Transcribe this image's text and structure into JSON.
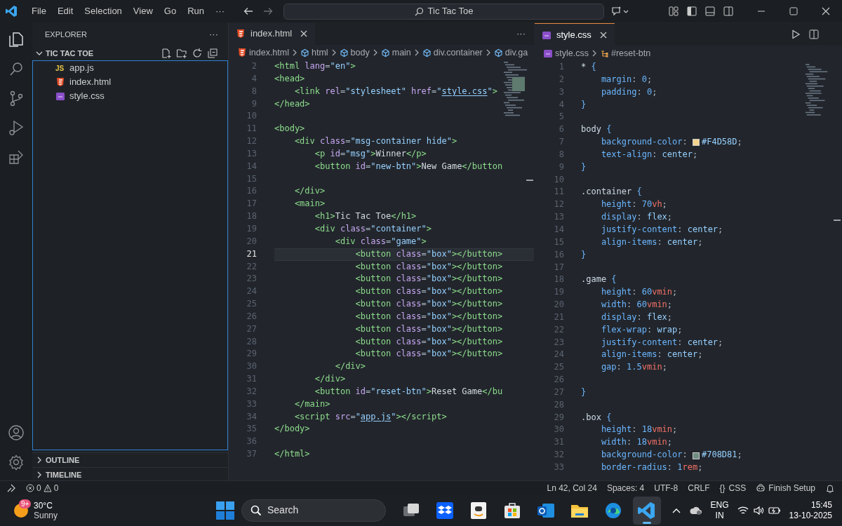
{
  "title_bar": {
    "menu": [
      "File",
      "Edit",
      "Selection",
      "View",
      "Go",
      "Run",
      "···"
    ],
    "search": "Tic Tac Toe"
  },
  "sidebar": {
    "title": "EXPLORER",
    "more": "···",
    "folder": {
      "name": "TIC TAC TOE",
      "expanded": true,
      "files": [
        {
          "name": "app.js",
          "kind": "js",
          "badge": "JS"
        },
        {
          "name": "index.html",
          "kind": "html"
        },
        {
          "name": "style.css",
          "kind": "css"
        }
      ]
    },
    "sections": [
      {
        "name": "OUTLINE",
        "expanded": false
      },
      {
        "name": "TIMELINE",
        "expanded": false
      }
    ]
  },
  "editors": [
    {
      "focused": false,
      "more": "···",
      "tabs": [
        {
          "label": "index.html",
          "kind": "html",
          "selected": true
        }
      ],
      "breadcrumbs": [
        {
          "label": "index.html",
          "kind": "html"
        },
        {
          "label": "html",
          "kind": "element"
        },
        {
          "label": "body",
          "kind": "element"
        },
        {
          "label": "main",
          "kind": "element"
        },
        {
          "label": "div.container",
          "kind": "element"
        },
        {
          "label": "div.ga",
          "kind": "element"
        }
      ],
      "lines": [
        {
          "number": "2",
          "current": false,
          "tokens": [
            {
              "kind": "tag",
              "text": "<html"
            },
            {
              "kind": "attr",
              "text": " lang"
            },
            {
              "kind": "p",
              "text": "="
            },
            {
              "kind": "str",
              "text": "\"en\""
            },
            {
              "kind": "tag",
              "text": ">"
            }
          ]
        },
        {
          "number": "4",
          "current": false,
          "tokens": [
            {
              "kind": "tag",
              "text": "<head>"
            }
          ]
        },
        {
          "number": "8",
          "current": false,
          "tokens": [
            {
              "kind": "tag",
              "text": "    <link"
            },
            {
              "kind": "attr",
              "text": " rel"
            },
            {
              "kind": "p",
              "text": "="
            },
            {
              "kind": "str",
              "text": "\"stylesheet\""
            },
            {
              "kind": "attr",
              "text": " href"
            },
            {
              "kind": "p",
              "text": "="
            },
            {
              "kind": "str",
              "text": "\""
            },
            {
              "kind": "link",
              "text": "style.css"
            },
            {
              "kind": "str",
              "text": "\""
            },
            {
              "kind": "tag",
              "text": ">"
            }
          ]
        },
        {
          "number": "9",
          "current": false,
          "tokens": [
            {
              "kind": "tag",
              "text": "</head>"
            }
          ]
        },
        {
          "number": "10",
          "current": false
        },
        {
          "number": "11",
          "current": false,
          "tokens": [
            {
              "kind": "tag",
              "text": "<body>"
            }
          ]
        },
        {
          "number": "12",
          "current": false,
          "tokens": [
            {
              "kind": "tag",
              "text": "    <div"
            },
            {
              "kind": "attr",
              "text": " class"
            },
            {
              "kind": "p",
              "text": "="
            },
            {
              "kind": "str",
              "text": "\"msg-container hide\""
            },
            {
              "kind": "tag",
              "text": ">"
            }
          ]
        },
        {
          "number": "13",
          "current": false,
          "tokens": [
            {
              "kind": "tag",
              "text": "        <p"
            },
            {
              "kind": "attr",
              "text": " id"
            },
            {
              "kind": "p",
              "text": "="
            },
            {
              "kind": "str",
              "text": "\"msg\""
            },
            {
              "kind": "tag",
              "text": ">"
            },
            {
              "kind": "text",
              "text": "Winner"
            },
            {
              "kind": "tag",
              "text": "</p>"
            }
          ]
        },
        {
          "number": "14",
          "current": false,
          "tokens": [
            {
              "kind": "tag",
              "text": "        <button"
            },
            {
              "kind": "attr",
              "text": " id"
            },
            {
              "kind": "p",
              "text": "="
            },
            {
              "kind": "str",
              "text": "\"new-btn\""
            },
            {
              "kind": "tag",
              "text": ">"
            },
            {
              "kind": "text",
              "text": "New Game"
            },
            {
              "kind": "tag",
              "text": "</button"
            }
          ]
        },
        {
          "number": "15",
          "current": false
        },
        {
          "number": "16",
          "current": false,
          "tokens": [
            {
              "kind": "tag",
              "text": "    </div>"
            }
          ]
        },
        {
          "number": "17",
          "current": false,
          "tokens": [
            {
              "kind": "tag",
              "text": "    <main>"
            }
          ]
        },
        {
          "number": "18",
          "current": false,
          "tokens": [
            {
              "kind": "tag",
              "text": "        <h1>"
            },
            {
              "kind": "text",
              "text": "Tic Tac Toe"
            },
            {
              "kind": "tag",
              "text": "</h1>"
            }
          ]
        },
        {
          "number": "19",
          "current": false,
          "tokens": [
            {
              "kind": "tag",
              "text": "        <div"
            },
            {
              "kind": "attr",
              "text": " class"
            },
            {
              "kind": "p",
              "text": "="
            },
            {
              "kind": "str",
              "text": "\"container\""
            },
            {
              "kind": "tag",
              "text": ">"
            }
          ]
        },
        {
          "number": "20",
          "current": false,
          "tokens": [
            {
              "kind": "tag",
              "text": "            <div"
            },
            {
              "kind": "attr",
              "text": " class"
            },
            {
              "kind": "p",
              "text": "="
            },
            {
              "kind": "str",
              "text": "\"game\""
            },
            {
              "kind": "tag",
              "text": ">"
            }
          ]
        },
        {
          "number": "21",
          "current": true,
          "tokens": [
            {
              "kind": "tag",
              "text": "                <button"
            },
            {
              "kind": "attr",
              "text": " class"
            },
            {
              "kind": "p",
              "text": "="
            },
            {
              "kind": "str",
              "text": "\"box\""
            },
            {
              "kind": "tag",
              "text": "></button>"
            }
          ]
        },
        {
          "number": "22",
          "current": false,
          "tokens": [
            {
              "kind": "tag",
              "text": "                <button"
            },
            {
              "kind": "attr",
              "text": " class"
            },
            {
              "kind": "p",
              "text": "="
            },
            {
              "kind": "str",
              "text": "\"box\""
            },
            {
              "kind": "tag",
              "text": "></button>"
            }
          ]
        },
        {
          "number": "23",
          "current": false,
          "tokens": [
            {
              "kind": "tag",
              "text": "                <button"
            },
            {
              "kind": "attr",
              "text": " class"
            },
            {
              "kind": "p",
              "text": "="
            },
            {
              "kind": "str",
              "text": "\"box\""
            },
            {
              "kind": "tag",
              "text": "></button>"
            }
          ]
        },
        {
          "number": "24",
          "current": false,
          "tokens": [
            {
              "kind": "tag",
              "text": "                <button"
            },
            {
              "kind": "attr",
              "text": " class"
            },
            {
              "kind": "p",
              "text": "="
            },
            {
              "kind": "str",
              "text": "\"box\""
            },
            {
              "kind": "tag",
              "text": "></button>"
            }
          ]
        },
        {
          "number": "25",
          "current": false,
          "tokens": [
            {
              "kind": "tag",
              "text": "                <button"
            },
            {
              "kind": "attr",
              "text": " class"
            },
            {
              "kind": "p",
              "text": "="
            },
            {
              "kind": "str",
              "text": "\"box\""
            },
            {
              "kind": "tag",
              "text": "></button>"
            }
          ]
        },
        {
          "number": "26",
          "current": false,
          "tokens": [
            {
              "kind": "tag",
              "text": "                <button"
            },
            {
              "kind": "attr",
              "text": " class"
            },
            {
              "kind": "p",
              "text": "="
            },
            {
              "kind": "str",
              "text": "\"box\""
            },
            {
              "kind": "tag",
              "text": "></button>"
            }
          ]
        },
        {
          "number": "27",
          "current": false,
          "tokens": [
            {
              "kind": "tag",
              "text": "                <button"
            },
            {
              "kind": "attr",
              "text": " class"
            },
            {
              "kind": "p",
              "text": "="
            },
            {
              "kind": "str",
              "text": "\"box\""
            },
            {
              "kind": "tag",
              "text": "></button>"
            }
          ]
        },
        {
          "number": "28",
          "current": false,
          "tokens": [
            {
              "kind": "tag",
              "text": "                <button"
            },
            {
              "kind": "attr",
              "text": " class"
            },
            {
              "kind": "p",
              "text": "="
            },
            {
              "kind": "str",
              "text": "\"box\""
            },
            {
              "kind": "tag",
              "text": "></button>"
            }
          ]
        },
        {
          "number": "29",
          "current": false,
          "tokens": [
            {
              "kind": "tag",
              "text": "                <button"
            },
            {
              "kind": "attr",
              "text": " class"
            },
            {
              "kind": "p",
              "text": "="
            },
            {
              "kind": "str",
              "text": "\"box\""
            },
            {
              "kind": "tag",
              "text": "></button>"
            }
          ]
        },
        {
          "number": "30",
          "current": false,
          "tokens": [
            {
              "kind": "tag",
              "text": "            </div>"
            }
          ]
        },
        {
          "number": "31",
          "current": false,
          "tokens": [
            {
              "kind": "tag",
              "text": "        </div>"
            }
          ]
        },
        {
          "number": "32",
          "current": false,
          "tokens": [
            {
              "kind": "tag",
              "text": "        <button"
            },
            {
              "kind": "attr",
              "text": " id"
            },
            {
              "kind": "p",
              "text": "="
            },
            {
              "kind": "str",
              "text": "\"reset-btn\""
            },
            {
              "kind": "tag",
              "text": ">"
            },
            {
              "kind": "text",
              "text": "Reset Game"
            },
            {
              "kind": "tag",
              "text": "</bu"
            }
          ]
        },
        {
          "number": "33",
          "current": false,
          "tokens": [
            {
              "kind": "tag",
              "text": "    </main>"
            }
          ]
        },
        {
          "number": "34",
          "current": false,
          "tokens": [
            {
              "kind": "tag",
              "text": "    <script"
            },
            {
              "kind": "attr",
              "text": " src"
            },
            {
              "kind": "p",
              "text": "="
            },
            {
              "kind": "str",
              "text": "\""
            },
            {
              "kind": "link",
              "text": "app.js"
            },
            {
              "kind": "str",
              "text": "\""
            },
            {
              "kind": "tag",
              "text": "></script>"
            }
          ]
        },
        {
          "number": "35",
          "current": false,
          "tokens": [
            {
              "kind": "tag",
              "text": "</body>"
            }
          ]
        },
        {
          "number": "36",
          "current": false
        },
        {
          "number": "37",
          "current": false,
          "tokens": [
            {
              "kind": "tag",
              "text": "</html>"
            }
          ]
        }
      ]
    },
    {
      "focused": true,
      "tabs": [
        {
          "label": "style.css",
          "kind": "css",
          "selected": true
        }
      ],
      "breadcrumbs": [
        {
          "label": "style.css",
          "kind": "css"
        },
        {
          "label": "#reset-btn",
          "kind": "selector"
        }
      ],
      "lines": [
        {
          "number": "1",
          "tokens": [
            {
              "kind": "sel",
              "text": "*"
            },
            {
              "kind": "brace",
              "text": " {"
            }
          ]
        },
        {
          "number": "2",
          "tokens": [
            {
              "kind": "prop",
              "text": "    margin"
            },
            {
              "kind": "p",
              "text": ": "
            },
            {
              "kind": "num",
              "text": "0"
            },
            {
              "kind": "p",
              "text": ";"
            }
          ]
        },
        {
          "number": "3",
          "tokens": [
            {
              "kind": "prop",
              "text": "    padding"
            },
            {
              "kind": "p",
              "text": ": "
            },
            {
              "kind": "num",
              "text": "0"
            },
            {
              "kind": "p",
              "text": ";"
            }
          ]
        },
        {
          "number": "4",
          "tokens": [
            {
              "kind": "brace",
              "text": "}"
            }
          ]
        },
        {
          "number": "5"
        },
        {
          "number": "6",
          "tokens": [
            {
              "kind": "sel",
              "text": "body"
            },
            {
              "kind": "brace",
              "text": " {"
            }
          ]
        },
        {
          "number": "7",
          "tokens": [
            {
              "kind": "prop",
              "text": "    background-color"
            },
            {
              "kind": "p",
              "text": ": "
            },
            {
              "kind": "swatch",
              "color": "#f4d58d"
            },
            {
              "kind": "val",
              "text": "#F4D58D"
            },
            {
              "kind": "p",
              "text": ";"
            }
          ]
        },
        {
          "number": "8",
          "tokens": [
            {
              "kind": "prop",
              "text": "    text-align"
            },
            {
              "kind": "p",
              "text": ": "
            },
            {
              "kind": "val",
              "text": "center"
            },
            {
              "kind": "p",
              "text": ";"
            }
          ]
        },
        {
          "number": "9",
          "tokens": [
            {
              "kind": "brace",
              "text": "}"
            }
          ]
        },
        {
          "number": "10"
        },
        {
          "number": "11",
          "tokens": [
            {
              "kind": "sel",
              "text": ".container"
            },
            {
              "kind": "brace",
              "text": " {"
            }
          ]
        },
        {
          "number": "12",
          "tokens": [
            {
              "kind": "prop",
              "text": "    height"
            },
            {
              "kind": "p",
              "text": ": "
            },
            {
              "kind": "num",
              "text": "70"
            },
            {
              "kind": "unit",
              "text": "vh"
            },
            {
              "kind": "p",
              "text": ";"
            }
          ]
        },
        {
          "number": "13",
          "tokens": [
            {
              "kind": "prop",
              "text": "    display"
            },
            {
              "kind": "p",
              "text": ": "
            },
            {
              "kind": "val",
              "text": "flex"
            },
            {
              "kind": "p",
              "text": ";"
            }
          ]
        },
        {
          "number": "14",
          "tokens": [
            {
              "kind": "prop",
              "text": "    justify-content"
            },
            {
              "kind": "p",
              "text": ": "
            },
            {
              "kind": "val",
              "text": "center"
            },
            {
              "kind": "p",
              "text": ";"
            }
          ]
        },
        {
          "number": "15",
          "tokens": [
            {
              "kind": "prop",
              "text": "    align-items"
            },
            {
              "kind": "p",
              "text": ": "
            },
            {
              "kind": "val",
              "text": "center"
            },
            {
              "kind": "p",
              "text": ";"
            }
          ]
        },
        {
          "number": "16",
          "tokens": [
            {
              "kind": "brace",
              "text": "}"
            }
          ]
        },
        {
          "number": "17"
        },
        {
          "number": "18",
          "tokens": [
            {
              "kind": "sel",
              "text": ".game"
            },
            {
              "kind": "brace",
              "text": " {"
            }
          ]
        },
        {
          "number": "19",
          "tokens": [
            {
              "kind": "prop",
              "text": "    height"
            },
            {
              "kind": "p",
              "text": ": "
            },
            {
              "kind": "num",
              "text": "60"
            },
            {
              "kind": "unit",
              "text": "vmin"
            },
            {
              "kind": "p",
              "text": ";"
            }
          ]
        },
        {
          "number": "20",
          "tokens": [
            {
              "kind": "prop",
              "text": "    width"
            },
            {
              "kind": "p",
              "text": ": "
            },
            {
              "kind": "num",
              "text": "60"
            },
            {
              "kind": "unit",
              "text": "vmin"
            },
            {
              "kind": "p",
              "text": ";"
            }
          ]
        },
        {
          "number": "21",
          "tokens": [
            {
              "kind": "prop",
              "text": "    display"
            },
            {
              "kind": "p",
              "text": ": "
            },
            {
              "kind": "val",
              "text": "flex"
            },
            {
              "kind": "p",
              "text": ";"
            }
          ]
        },
        {
          "number": "22",
          "tokens": [
            {
              "kind": "prop",
              "text": "    flex-wrap"
            },
            {
              "kind": "p",
              "text": ": "
            },
            {
              "kind": "val",
              "text": "wrap"
            },
            {
              "kind": "p",
              "text": ";"
            }
          ]
        },
        {
          "number": "23",
          "tokens": [
            {
              "kind": "prop",
              "text": "    justify-content"
            },
            {
              "kind": "p",
              "text": ": "
            },
            {
              "kind": "val",
              "text": "center"
            },
            {
              "kind": "p",
              "text": ";"
            }
          ]
        },
        {
          "number": "24",
          "tokens": [
            {
              "kind": "prop",
              "text": "    align-items"
            },
            {
              "kind": "p",
              "text": ": "
            },
            {
              "kind": "val",
              "text": "center"
            },
            {
              "kind": "p",
              "text": ";"
            }
          ]
        },
        {
          "number": "25",
          "tokens": [
            {
              "kind": "prop",
              "text": "    gap"
            },
            {
              "kind": "p",
              "text": ": "
            },
            {
              "kind": "num",
              "text": "1.5"
            },
            {
              "kind": "unit",
              "text": "vmin"
            },
            {
              "kind": "p",
              "text": ";"
            }
          ]
        },
        {
          "number": "26"
        },
        {
          "number": "27",
          "tokens": [
            {
              "kind": "brace",
              "text": "}"
            }
          ]
        },
        {
          "number": "28"
        },
        {
          "number": "29",
          "tokens": [
            {
              "kind": "sel",
              "text": ".box"
            },
            {
              "kind": "brace",
              "text": " {"
            }
          ]
        },
        {
          "number": "30",
          "tokens": [
            {
              "kind": "prop",
              "text": "    height"
            },
            {
              "kind": "p",
              "text": ": "
            },
            {
              "kind": "num",
              "text": "18"
            },
            {
              "kind": "unit",
              "text": "vmin"
            },
            {
              "kind": "p",
              "text": ";"
            }
          ]
        },
        {
          "number": "31",
          "tokens": [
            {
              "kind": "prop",
              "text": "    width"
            },
            {
              "kind": "p",
              "text": ": "
            },
            {
              "kind": "num",
              "text": "18"
            },
            {
              "kind": "unit",
              "text": "vmin"
            },
            {
              "kind": "p",
              "text": ";"
            }
          ]
        },
        {
          "number": "32",
          "tokens": [
            {
              "kind": "prop",
              "text": "    background-color"
            },
            {
              "kind": "p",
              "text": ": "
            },
            {
              "kind": "swatch",
              "color": "#708d81"
            },
            {
              "kind": "val",
              "text": "#708D81"
            },
            {
              "kind": "p",
              "text": ";"
            }
          ]
        },
        {
          "number": "33",
          "tokens": [
            {
              "kind": "prop",
              "text": "    border-radius"
            },
            {
              "kind": "p",
              "text": ": "
            },
            {
              "kind": "num",
              "text": "1"
            },
            {
              "kind": "unit",
              "text": "rem"
            },
            {
              "kind": "p",
              "text": ";"
            }
          ]
        }
      ]
    }
  ],
  "status_bar": {
    "errors": "0",
    "warnings": "0",
    "items": [
      "Ln 42, Col 24",
      "Spaces: 4",
      "UTF-8",
      "CRLF"
    ],
    "language": {
      "icon": "{}",
      "label": "CSS"
    },
    "setup": "Finish Setup"
  },
  "taskbar": {
    "weather": {
      "badge": "9+",
      "temperature": "30°C",
      "condition": "Sunny"
    },
    "search": "Search",
    "apps": [
      {
        "kind": "taskview",
        "active": false
      },
      {
        "kind": "dropbox",
        "active": false
      },
      {
        "kind": "amazon",
        "active": false
      },
      {
        "kind": "store",
        "active": false
      },
      {
        "kind": "outlook",
        "active": false
      },
      {
        "kind": "files",
        "active": false
      },
      {
        "kind": "edge",
        "active": false
      },
      {
        "kind": "vscode",
        "active": true
      }
    ],
    "language": [
      "ENG",
      "IN"
    ],
    "time": "15:45",
    "date": "13-10-2025"
  }
}
